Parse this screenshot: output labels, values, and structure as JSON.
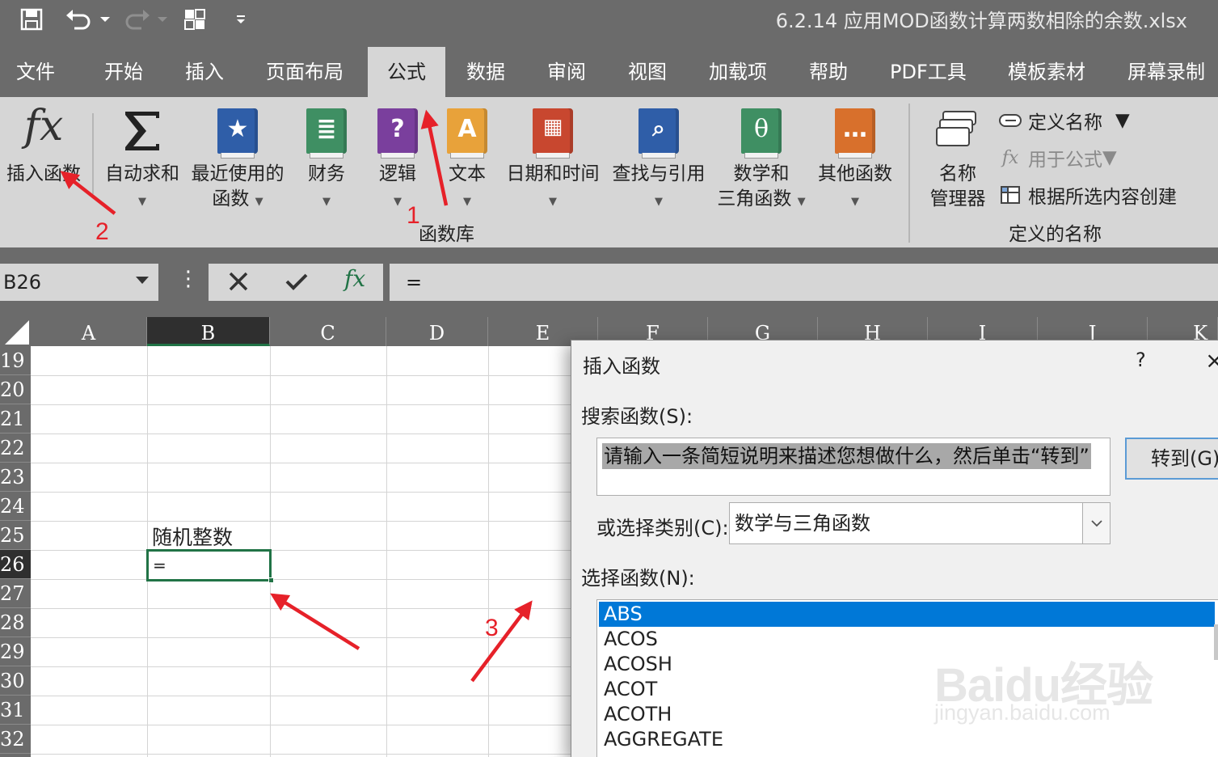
{
  "window": {
    "title": "6.2.14  应用MOD函数计算两数相除的余数.xlsx"
  },
  "ribbon_tabs": [
    "文件",
    "开始",
    "插入",
    "页面布局",
    "公式",
    "数据",
    "审阅",
    "视图",
    "加载项",
    "帮助",
    "PDF工具",
    "模板素材",
    "屏幕录制"
  ],
  "active_tab": "公式",
  "function_library": {
    "insert_function": "插入函数",
    "autosum": "自动求和",
    "recent_1": "最近使用的",
    "recent_2": "函数",
    "financial": "财务",
    "logical": "逻辑",
    "text": "文本",
    "datetime": "日期和时间",
    "lookup": "查找与引用",
    "math_1": "数学和",
    "math_2": "三角函数",
    "more": "其他函数",
    "group_label": "函数库"
  },
  "defined_names": {
    "name_manager_1": "名称",
    "name_manager_2": "管理器",
    "define_name": "定义名称",
    "use_in_formula": "用于公式",
    "create_from_selection": "根据所选内容创建",
    "group_label": "定义的名称"
  },
  "formula_bar": {
    "name_box": "B26",
    "formula": "=",
    "fx": "fx"
  },
  "sheet": {
    "columns": [
      "A",
      "B",
      "C",
      "D",
      "E",
      "F",
      "G",
      "H",
      "I",
      "J",
      "K"
    ],
    "rows": [
      "19",
      "20",
      "21",
      "22",
      "23",
      "24",
      "25",
      "26",
      "27",
      "28",
      "29",
      "30",
      "31",
      "32"
    ],
    "selected_column": "B",
    "selected_row": "26",
    "cell_b25": "随机整数",
    "cell_b26": "="
  },
  "dialog": {
    "title": "插入函数",
    "help": "?",
    "close": "×",
    "search_label": "搜索函数(S):",
    "search_placeholder": "请输入一条简短说明来描述您想做什么，然后单击“转到”",
    "go_button": "转到(G)",
    "category_label": "或选择类别(C):",
    "category_value": "数学与三角函数",
    "function_label": "选择函数(N):",
    "functions": [
      "ABS",
      "ACOS",
      "ACOSH",
      "ACOT",
      "ACOTH",
      "AGGREGATE"
    ],
    "selected_function": "ABS"
  },
  "annotations": {
    "step1": "1",
    "step2": "2",
    "step3": "3",
    "arrow_color": "#e62129"
  },
  "watermark": {
    "main": "Baidu经验",
    "sub": "jingyan.baidu.com"
  }
}
